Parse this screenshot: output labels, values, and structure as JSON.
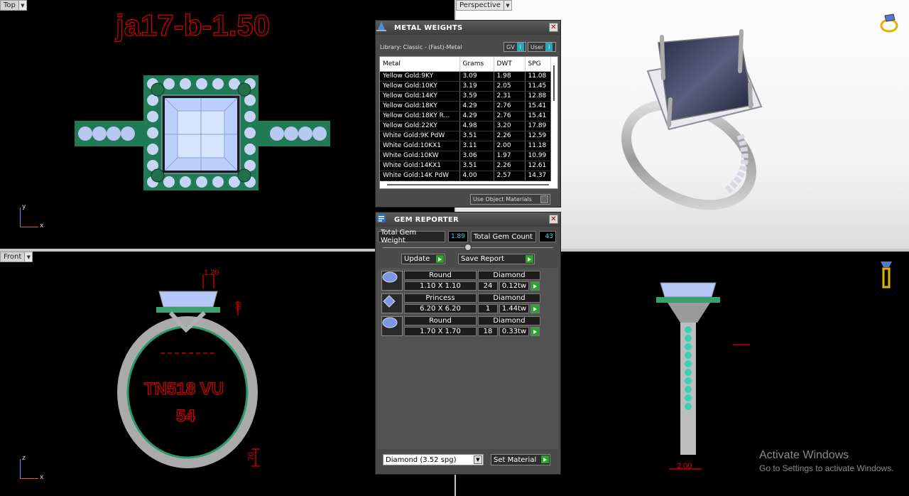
{
  "viewports": {
    "top": {
      "label": "Top",
      "title": "ja17-b-1.50",
      "axis_v": "y",
      "axis_h": "x"
    },
    "perspective": {
      "label": "Perspective"
    },
    "front": {
      "label": "Front",
      "text_line1": "TN518 VU",
      "text_line2": "54",
      "dim_top": "1.20",
      "dim_mid": "60",
      "dim_bottom": "70",
      "axis_v": "z",
      "axis_h": "x"
    },
    "right": {
      "dim_bottom": "2.00"
    }
  },
  "metal_weights": {
    "title": "METAL WEIGHTS",
    "library": "Library: Classic - (Fast)-Metal",
    "gv_label": "GV",
    "user_label": "User",
    "info_glyph": "i",
    "columns": [
      "Metal",
      "Grams",
      "DWT",
      "SPG"
    ],
    "rows": [
      [
        "Yellow Gold:9KY",
        "3.09",
        "1.98",
        "11.08"
      ],
      [
        "Yellow Gold:10KY",
        "3.19",
        "2.05",
        "11.45"
      ],
      [
        "Yellow Gold:14KY",
        "3.59",
        "2.31",
        "12.88"
      ],
      [
        "Yellow Gold:18KY",
        "4.29",
        "2.76",
        "15.41"
      ],
      [
        "Yellow Gold:18KY R...",
        "4.29",
        "2.76",
        "15.41"
      ],
      [
        "Yellow Gold:22KY",
        "4.98",
        "3.20",
        "17.89"
      ],
      [
        "White Gold:9K PdW",
        "3.51",
        "2.26",
        "12.59"
      ],
      [
        "White Gold:10KX1",
        "3.11",
        "2.00",
        "11.18"
      ],
      [
        "White Gold:10KW",
        "3.06",
        "1.97",
        "10.99"
      ],
      [
        "White Gold:14KX1",
        "3.51",
        "2.26",
        "12.61"
      ],
      [
        "White Gold:14K PdW",
        "4.00",
        "2.57",
        "14.37"
      ]
    ],
    "use_object_materials": "Use Object Materials"
  },
  "gem_reporter": {
    "title": "GEM REPORTER",
    "total_weight_label": "Total Gem Weight",
    "total_weight_value": "1.89",
    "total_count_label": "Total Gem Count",
    "total_count_value": "43",
    "update_label": "Update",
    "save_report_label": "Save Report",
    "gems": [
      {
        "cut": "Round",
        "size": "1.10 X 1.10",
        "material": "Diamond",
        "count": "24",
        "weight": "0.12tw"
      },
      {
        "cut": "Princess",
        "size": "6.20 X 6.20",
        "material": "Diamond",
        "count": "1",
        "weight": "1.44tw"
      },
      {
        "cut": "Round",
        "size": "1.70 X 1.70",
        "material": "Diamond",
        "count": "18",
        "weight": "0.33tw"
      }
    ],
    "material_select": "Diamond     (3.52 spg)",
    "set_material_label": "Set Material"
  },
  "windows_activation": {
    "line1": "Activate Windows",
    "line2": "Go to Settings to activate Windows."
  }
}
